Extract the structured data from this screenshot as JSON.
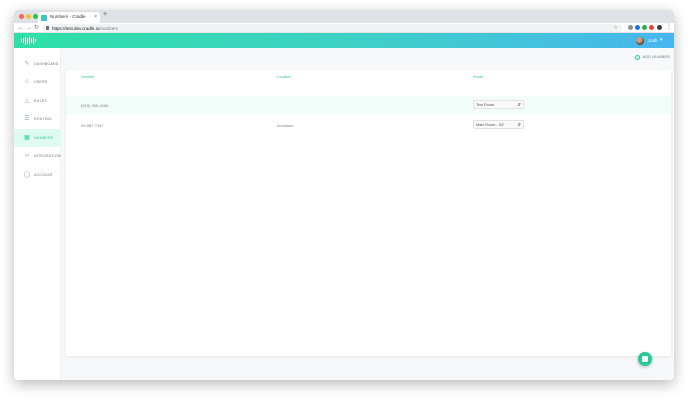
{
  "browser": {
    "tab_title": "Numbers - Cradle",
    "tab_close": "×",
    "new_tab": "+",
    "url_host": "https://test.dev.cradle.io",
    "url_path": "/numbers",
    "icons": [
      "back-icon",
      "forward-icon",
      "reload-icon",
      "lock-icon",
      "star-icon",
      "menu-kebab-icon"
    ]
  },
  "header": {
    "logo": "cradle-waveform-logo",
    "username": "Josh",
    "brand_gradient": [
      "#2ee0a6",
      "#47b6ee"
    ]
  },
  "sidebar": {
    "items": [
      {
        "label": "DASHBOARD",
        "icon": "pencil-icon",
        "active": false
      },
      {
        "label": "USERS",
        "icon": "users-icon",
        "active": false
      },
      {
        "label": "RULES",
        "icon": "rules-icon",
        "active": false
      },
      {
        "label": "ROUTING",
        "icon": "routing-icon",
        "active": false
      },
      {
        "label": "NUMBERS",
        "icon": "numbers-icon",
        "active": true
      },
      {
        "label": "INTEGRATIONS",
        "icon": "link-icon",
        "active": false
      },
      {
        "label": "ACCOUNT",
        "icon": "account-icon",
        "active": false
      }
    ],
    "active_color": "#26c997"
  },
  "main": {
    "add_number_label": "ADD NUMBER",
    "table": {
      "columns": [
        "Number",
        "Location",
        "Route"
      ],
      "rows": [
        {
          "number": "(619) 356-4068",
          "location": "",
          "route": "Test Route"
        },
        {
          "number": "09-887 7347",
          "location": "Auckland",
          "route": "Main Route - NZ"
        }
      ]
    }
  },
  "chat_widget": {
    "icon": "chat-icon",
    "color": "#26c997"
  }
}
